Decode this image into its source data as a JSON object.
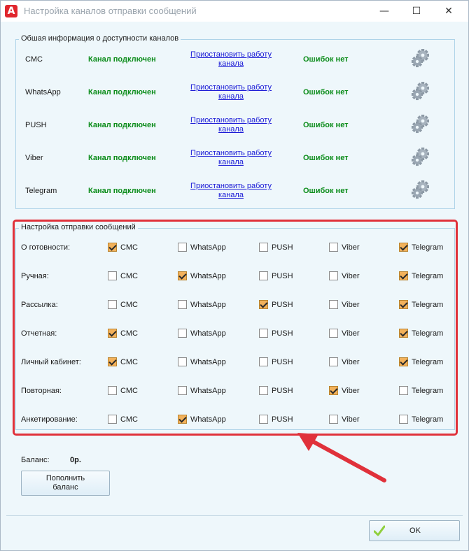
{
  "window": {
    "title": "Настройка каналов отправки сообщений",
    "buttons": {
      "minimize": "—",
      "maximize": "☐",
      "close": "✕"
    }
  },
  "availability": {
    "caption": "Обшая информация о доступности каналов",
    "channels": [
      {
        "name": "СМС",
        "status": "Канал подключен",
        "action": "Приостановить работу канала",
        "errors": "Ошибок нет"
      },
      {
        "name": "WhatsApp",
        "status": "Канал подключен",
        "action": "Приостановить работу канала",
        "errors": "Ошибок нет"
      },
      {
        "name": "PUSH",
        "status": "Канал подключен",
        "action": "Приостановить работу канала",
        "errors": "Ошибок нет"
      },
      {
        "name": "Viber",
        "status": "Канал подключен",
        "action": "Приостановить работу канала",
        "errors": "Ошибок нет"
      },
      {
        "name": "Telegram",
        "status": "Канал подключен",
        "action": "Приостановить работу канала",
        "errors": "Ошибок нет"
      }
    ]
  },
  "sending": {
    "caption": "Настройка отправки сообщений",
    "channels": [
      "СМС",
      "WhatsApp",
      "PUSH",
      "Viber",
      "Telegram"
    ],
    "rows": [
      {
        "label": "О готовности:",
        "checked": [
          true,
          false,
          false,
          false,
          true
        ]
      },
      {
        "label": "Ручная:",
        "checked": [
          false,
          true,
          false,
          false,
          true
        ]
      },
      {
        "label": "Рассылка:",
        "checked": [
          false,
          false,
          true,
          false,
          true
        ]
      },
      {
        "label": "Отчетная:",
        "checked": [
          true,
          false,
          false,
          false,
          true
        ]
      },
      {
        "label": "Личный кабинет:",
        "checked": [
          true,
          false,
          false,
          false,
          true
        ]
      },
      {
        "label": "Повторная:",
        "checked": [
          false,
          false,
          false,
          true,
          false
        ]
      },
      {
        "label": "Анкетирование:",
        "checked": [
          false,
          true,
          false,
          false,
          false
        ]
      }
    ]
  },
  "balance": {
    "label": "Баланс:",
    "value": "0р.",
    "topup_label": "Пополнить баланс"
  },
  "ok_label": "OK",
  "colors": {
    "highlight": "#e0313a",
    "status_ok": "#0b8c1a",
    "link": "#1b1bd6",
    "checkbox_on": "#f2b15a"
  }
}
